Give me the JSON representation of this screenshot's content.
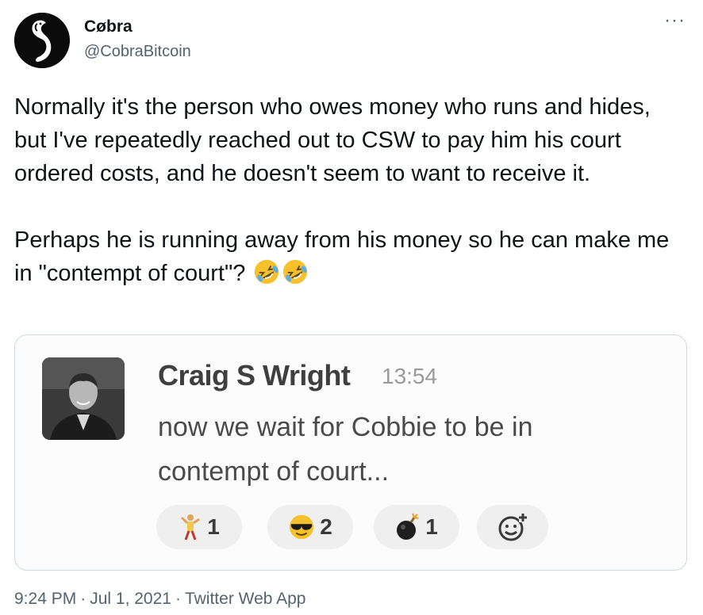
{
  "author": {
    "name": "Cøbra",
    "handle": "@CobraBitcoin",
    "more_label": "···"
  },
  "tweet": {
    "paragraph1": "Normally it's the person who owes money who runs and hides, but I've repeatedly reached out to CSW to pay him his court ordered costs, and he doesn't seem to want to receive it.",
    "paragraph2": "Perhaps he is running away from his money so he can make me in \"contempt of court\"?",
    "trailing_emoji": [
      "rolling-on-floor-laughing",
      "rolling-on-floor-laughing"
    ]
  },
  "embedded_message": {
    "sender": "Craig S Wright",
    "time": "13:54",
    "text": "now we wait for Cobbie to be in contempt of court...",
    "reactions": [
      {
        "icon": "dancing-figure",
        "count": "1"
      },
      {
        "icon": "sunglasses-face",
        "count": "2"
      },
      {
        "icon": "bomb",
        "count": "1"
      }
    ],
    "add_reaction_icon": "add-reaction"
  },
  "meta": {
    "time": "9:24 PM",
    "date": "Jul 1, 2021",
    "source": "Twitter Web App",
    "separator": "·"
  },
  "colors": {
    "text_primary": "#0f1419",
    "text_secondary": "#536471",
    "border": "#cfd9de",
    "emoji_yellow": "#f7c12b"
  }
}
